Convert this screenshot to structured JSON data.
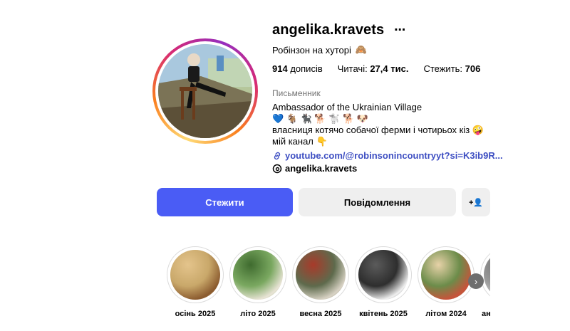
{
  "profile": {
    "username": "angelika.kravets",
    "more_icon": "⋯",
    "full_name": "Робінзон на хуторі",
    "full_name_emoji": "🙈",
    "stats": [
      {
        "value": "914",
        "label": "дописів"
      },
      {
        "label": "Читачі:",
        "value": "27,4 тис."
      },
      {
        "label": "Стежить:",
        "value": "706"
      }
    ],
    "category": "Письменник",
    "bio": [
      "Ambassador of the Ukrainian Village",
      "💙 🐐 🐈‍⬛ 🐕 🐩 🐕 🐶",
      "власниця котячо собачої ферми і чотирьох кіз 🤪",
      "мій канал 👇"
    ],
    "link": "youtube.com/@robinsonincountryyt?si=K3ib9R...",
    "threads_handle": "angelika.kravets"
  },
  "actions": {
    "follow": "Стежити",
    "message": "Повідомлення",
    "add_user_icon": "+👤"
  },
  "highlights": [
    {
      "label": "осінь 2025",
      "colors": [
        "#c9a86a",
        "#8a5a2e",
        "#e4c48c"
      ]
    },
    {
      "label": "літо 2025",
      "colors": [
        "#7aa860",
        "#e9e4d6",
        "#3f6b2f"
      ]
    },
    {
      "label": "весна 2025",
      "colors": [
        "#5e6a4c",
        "#d9d3c5",
        "#a83a2a"
      ]
    },
    {
      "label": "квітень 2025",
      "colors": [
        "#2e2e2e",
        "#f1f1f1",
        "#5b5b5b"
      ]
    },
    {
      "label": "літом 2024",
      "colors": [
        "#6c8c4a",
        "#c9523a",
        "#e7d2a8"
      ]
    },
    {
      "label": "ан",
      "colors": [
        "#9a9a9a",
        "#cfcfcf",
        "#6f6f6f"
      ]
    }
  ],
  "next_icon": "›"
}
